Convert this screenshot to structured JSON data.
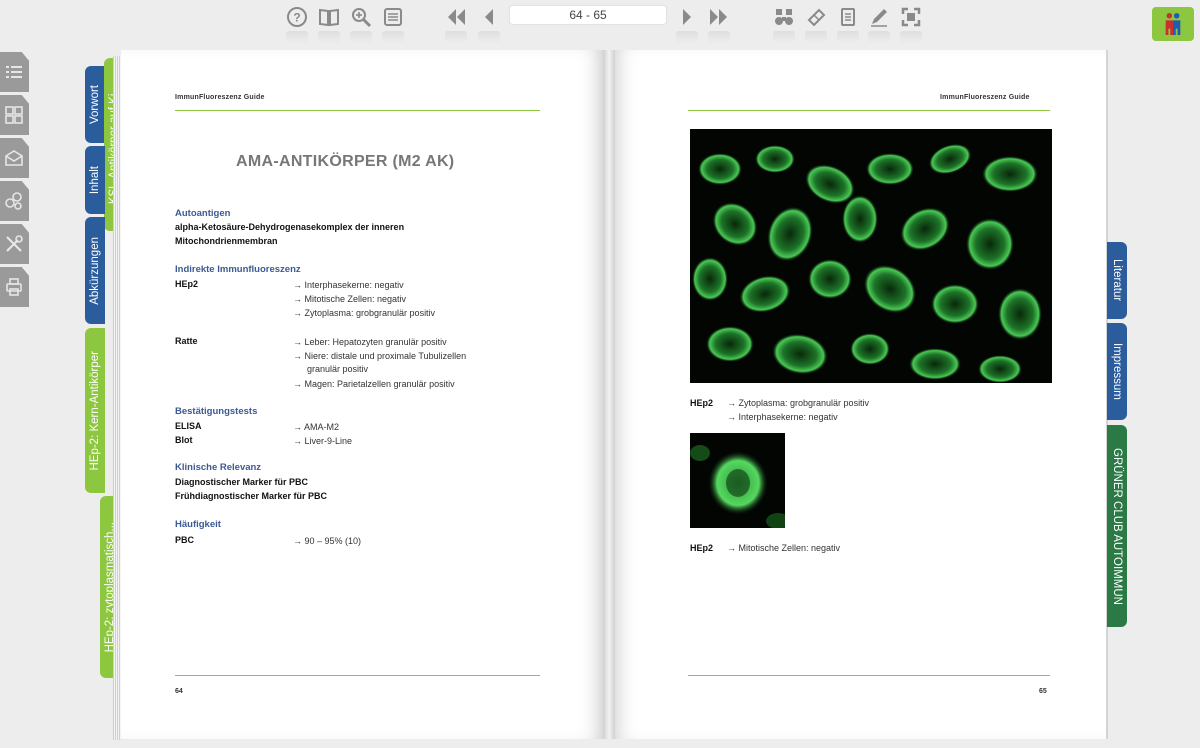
{
  "toolbar": {
    "page_indicator": "64 - 65",
    "buttons": [
      "help-icon",
      "book-icon",
      "zoom-icon",
      "thumbnails-icon",
      "first-page-icon",
      "prev-page-icon",
      "next-page-icon",
      "last-page-icon",
      "binoculars-icon",
      "bookmark-icon",
      "notes-icon",
      "pencil-icon",
      "fullscreen-icon"
    ]
  },
  "side_menu": [
    "list-icon",
    "grid-icon",
    "mail-icon",
    "share-icon",
    "tools-icon",
    "print-icon"
  ],
  "left_tabs": [
    {
      "label": "Vorwort",
      "color": "#2b5c9c"
    },
    {
      "label": "KSL-Antikörper auf Ki...",
      "color": "#8dc63f"
    },
    {
      "label": "Inhalt",
      "color": "#2b5c9c"
    },
    {
      "label": "Abkürzungen",
      "color": "#2b5c9c"
    },
    {
      "label": "HEp-2: Kern-Antikörper",
      "color": "#8dc63f"
    },
    {
      "label": "HEp-2: zytoplasmatisch...",
      "color": "#8dc63f"
    }
  ],
  "right_tabs": [
    {
      "label": "Literatur",
      "color": "#2b5c9c"
    },
    {
      "label": "Impressum",
      "color": "#2b5c9c"
    },
    {
      "label": "GRÜNER CLUB AUTOIMMUN",
      "color": "#2b7a46"
    }
  ],
  "left_page": {
    "running_head": "ImmunFluoreszenz Guide",
    "title": "AMA-ANTIKÖRPER (M2 AK)",
    "page_number": "64",
    "autoantigen_heading": "Autoantigen",
    "autoantigen_line1": "alpha-Ketosäure-Dehydrogenasekomplex der inneren",
    "autoantigen_line2": "Mitochondrienmembran",
    "iif_heading": "Indirekte Immunfluoreszenz",
    "hep2_label": "HEp2",
    "hep2_results": [
      "→ Interphasekerne: negativ",
      "→ Mitotische Zellen: negativ",
      "→ Zytoplasma: grobgranulär positiv"
    ],
    "ratte_label": "Ratte",
    "ratte_results": [
      "→ Leber: Hepatozyten granulär positiv",
      "→ Niere: distale und proximale Tubulizellen",
      "granulär positiv",
      "→ Magen: Parietalzellen granulär positiv"
    ],
    "confirm_heading": "Bestätigungstests",
    "elisa_label": "ELISA",
    "elisa_value": "→ AMA-M2",
    "blot_label": "Blot",
    "blot_value": "→ Liver-9-Line",
    "clinical_heading": "Klinische Relevanz",
    "clinical_line1": "Diagnostischer Marker für PBC",
    "clinical_line2": "Frühdiagnostischer Marker für PBC",
    "freq_heading": "Häufigkeit",
    "pbc_label": "PBC",
    "pbc_value": "→ 90 – 95% (10)"
  },
  "right_page": {
    "running_head": "ImmunFluoreszenz Guide",
    "page_number": "65",
    "caption1_label": "HEp2",
    "caption1_lines": [
      "→ Zytoplasma: grobgranulär positiv",
      "→ Interphasekerne: negativ"
    ],
    "caption2_label": "HEp2",
    "caption2_line": "→ Mitotische Zellen: negativ"
  },
  "colors": {
    "brand_green": "#8dc63f",
    "tab_blue": "#2b5c9c",
    "tab_dark_green": "#2b7a46",
    "heading_blue": "#3c5a92"
  }
}
